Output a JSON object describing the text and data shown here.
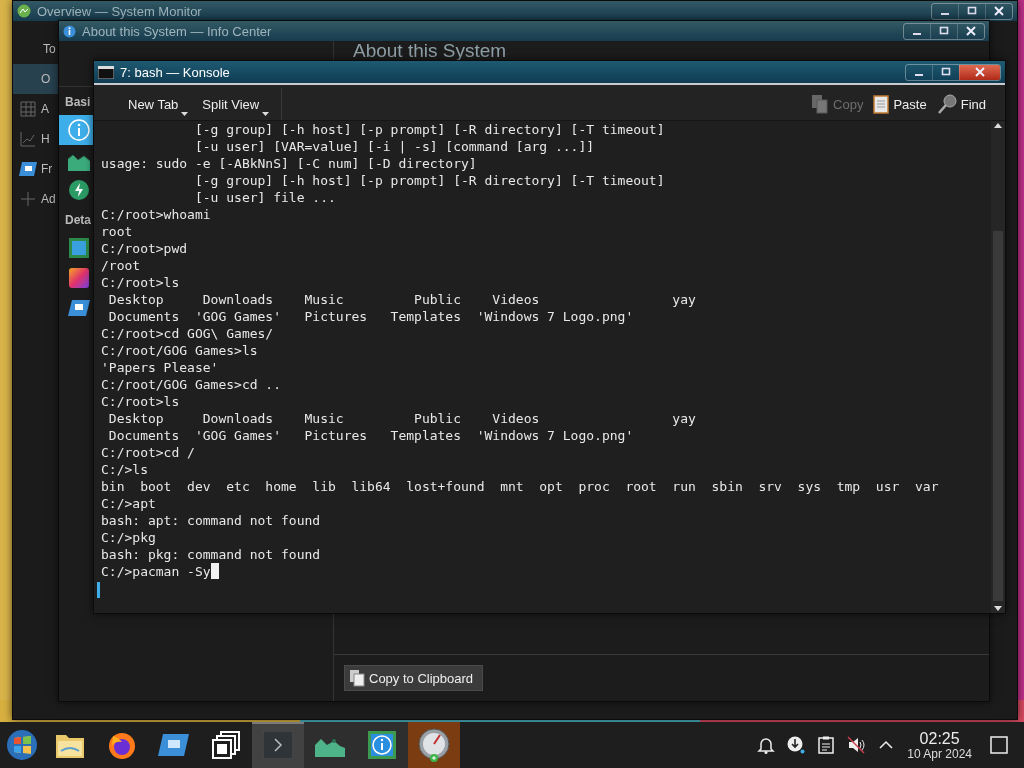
{
  "system_monitor": {
    "title": "Overview — System Monitor",
    "sidebar": [
      {
        "label": "To",
        "selected": false
      },
      {
        "label": "O",
        "selected": true
      },
      {
        "label": "A",
        "selected": false
      },
      {
        "label": "H",
        "selected": false
      },
      {
        "label": "Fr",
        "selected": false
      },
      {
        "label": "Ad",
        "selected": false
      }
    ]
  },
  "info_center": {
    "title": "About this System — Info Center",
    "sections": [
      {
        "title": "Basi",
        "items": [
          {
            "selected": true
          },
          {
            "selected": false
          },
          {
            "selected": false
          }
        ]
      },
      {
        "title": "Deta",
        "items": [
          {
            "selected": false
          },
          {
            "selected": false
          },
          {
            "selected": false
          }
        ]
      }
    ],
    "heading": "About this System",
    "button": "Copy to Clipboard"
  },
  "konsole": {
    "title": "7: bash — Konsole",
    "toolbar_left": [
      {
        "label": "New Tab"
      },
      {
        "label": "Split View"
      }
    ],
    "toolbar_right": [
      {
        "label": "Copy",
        "disabled": true
      },
      {
        "label": "Paste",
        "disabled": false
      },
      {
        "label": "Find",
        "disabled": false
      }
    ],
    "lines": [
      "            [-g group] [-h host] [-p prompt] [-R directory] [-T timeout]",
      "            [-u user] [VAR=value] [-i | -s] [command [arg ...]]",
      "usage: sudo -e [-ABkNnS] [-C num] [-D directory]",
      "            [-g group] [-h host] [-p prompt] [-R directory] [-T timeout]",
      "            [-u user] file ...",
      "C:/root>whoami",
      "root",
      "C:/root>pwd",
      "/root",
      "C:/root>ls",
      " Desktop     Downloads    Music         Public    Videos                 yay",
      " Documents  'GOG Games'   Pictures   Templates  'Windows 7 Logo.png'",
      "C:/root>cd GOG\\ Games/",
      "C:/root/GOG Games>ls",
      "'Papers Please'",
      "C:/root/GOG Games>cd ..",
      "C:/root>ls",
      " Desktop     Downloads    Music         Public    Videos                 yay",
      " Documents  'GOG Games'   Pictures   Templates  'Windows 7 Logo.png'",
      "C:/root>cd /",
      "C:/>ls",
      "bin  boot  dev  etc  home  lib  lib64  lost+found  mnt  opt  proc  root  run  sbin  srv  sys  tmp  usr  var",
      "C:/>apt",
      "bash: apt: command not found",
      "C:/>pkg",
      "bash: pkg: command not found",
      "C:/>pacman -Sy"
    ]
  },
  "taskbar": {
    "apps": [
      {
        "active": false,
        "running": false,
        "attention": false
      },
      {
        "active": false,
        "running": false,
        "attention": false
      },
      {
        "active": false,
        "running": false,
        "attention": false
      },
      {
        "active": false,
        "running": false,
        "attention": false
      },
      {
        "active": false,
        "running": false,
        "attention": false
      },
      {
        "active": true,
        "running": true,
        "attention": false
      },
      {
        "active": false,
        "running": true,
        "attention": false
      },
      {
        "active": false,
        "running": true,
        "attention": false
      },
      {
        "active": false,
        "running": true,
        "attention": true
      }
    ],
    "time": "02:25",
    "date": "10 Apr 2024"
  }
}
